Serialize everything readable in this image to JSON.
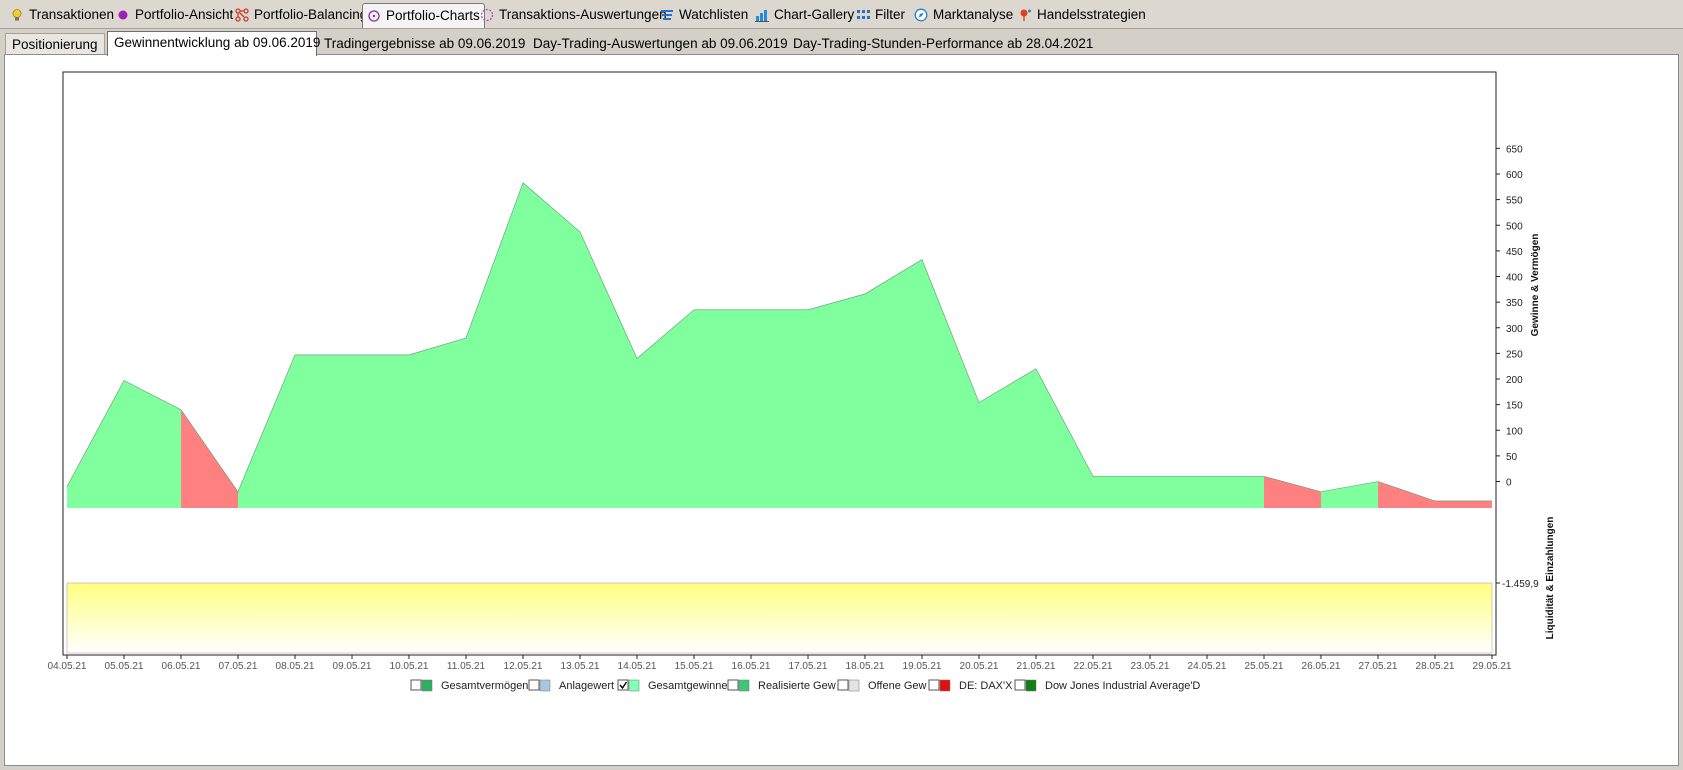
{
  "top_tabs": [
    {
      "label": "Transaktionen",
      "icon": "bulb-icon",
      "color": "#e8c020"
    },
    {
      "label": "Portfolio-Ansicht",
      "icon": "dot-icon",
      "color": "#9b1fb8"
    },
    {
      "label": "Portfolio-Balancing",
      "icon": "network-icon",
      "color": "#c8402a"
    },
    {
      "label": "Portfolio-Charts",
      "icon": "circle-icon",
      "color": "#8a2fa0",
      "active": true
    },
    {
      "label": "Transaktions-Auswertungen",
      "icon": "dashed-circle-icon",
      "color": "#b050c0"
    },
    {
      "label": "Watchlisten",
      "icon": "list-icon",
      "color": "#2a70c8"
    },
    {
      "label": "Chart-Gallery",
      "icon": "bar-chart-icon",
      "color": "#2a8ad8"
    },
    {
      "label": "Filter",
      "icon": "grid-icon",
      "color": "#2a70c8"
    },
    {
      "label": "Marktanalyse",
      "icon": "compass-icon",
      "color": "#2a80d0"
    },
    {
      "label": "Handelsstrategien",
      "icon": "pin-icon",
      "color": "#e04020"
    }
  ],
  "sub_tabs": [
    {
      "label": "Positionierung"
    },
    {
      "label": "Gewinnentwicklung ab 09.06.2019",
      "active": true
    },
    {
      "label": "Tradingergebnisse ab 09.06.2019"
    },
    {
      "label": "Day-Trading-Auswertungen ab 09.06.2019"
    },
    {
      "label": "Day-Trading-Stunden-Performance ab 28.04.2021"
    }
  ],
  "chart_data": {
    "type": "area",
    "x": [
      "04.05.21",
      "05.05.21",
      "06.05.21",
      "07.05.21",
      "08.05.21",
      "09.05.21",
      "10.05.21",
      "11.05.21",
      "12.05.21",
      "13.05.21",
      "14.05.21",
      "15.05.21",
      "16.05.21",
      "17.05.21",
      "18.05.21",
      "19.05.21",
      "20.05.21",
      "21.05.21",
      "22.05.21",
      "23.05.21",
      "24.05.21",
      "25.05.21",
      "26.05.21",
      "27.05.21",
      "28.05.21",
      "29.05.21"
    ],
    "series": [
      {
        "name": "Gesamtgewinne",
        "values": [
          -10,
          197,
          140,
          -20,
          247,
          247,
          247,
          280,
          583,
          487,
          240,
          335,
          335,
          335,
          366,
          433,
          154,
          220,
          10,
          10,
          10,
          10,
          -20,
          0,
          -38,
          -38
        ]
      }
    ],
    "ylabel_top": "Gewinne & Vermögen",
    "ylabel_bottom": "Liquidität & Einzahlungen",
    "y_ticks": [
      "650",
      "600",
      "550",
      "500",
      "450",
      "400",
      "350",
      "300",
      "250",
      "200",
      "150",
      "100",
      "50",
      "0"
    ],
    "ylim": [
      -40,
      650
    ],
    "liquidity_value_label": "-1.459,9",
    "colors": {
      "positive": "#80ff9f",
      "negative": "#ff8080",
      "liquidity_top": "#ffff80",
      "liquidity_bottom": "#ffffff"
    }
  },
  "legend": [
    {
      "label": "Gesamtvermögen",
      "checked": false,
      "color": "#2db060"
    },
    {
      "label": "Anlagewert",
      "checked": false,
      "color": "#a8c8e0"
    },
    {
      "label": "Gesamtgewinne",
      "checked": true,
      "color": "#80ffb0"
    },
    {
      "label": "Realisierte Gew",
      "checked": false,
      "color": "#3cc878"
    },
    {
      "label": "Offene Gew",
      "checked": false,
      "color": "#e4e4e4"
    },
    {
      "label": "DE: DAX'X",
      "checked": false,
      "color": "#e01010"
    },
    {
      "label": "Dow Jones Industrial Average'D",
      "checked": false,
      "color": "#108010"
    }
  ]
}
